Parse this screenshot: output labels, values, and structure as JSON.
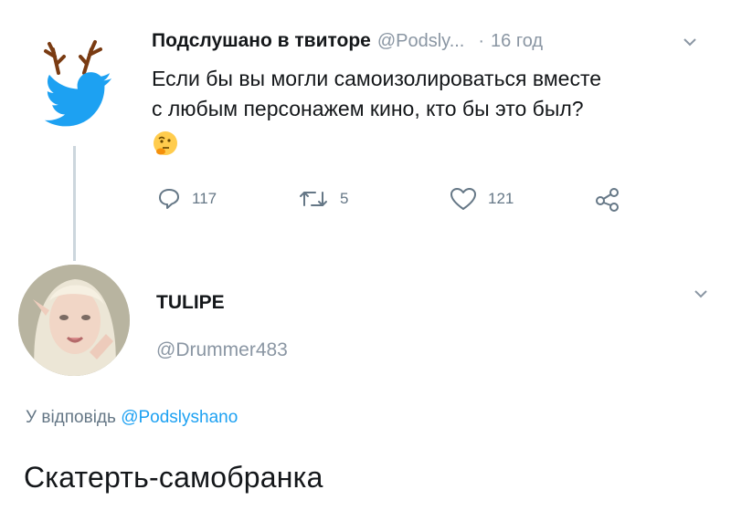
{
  "colors": {
    "accent": "#1da1f2",
    "muted": "#8a96a3",
    "text": "#14171a",
    "antler": "#7a3b12"
  },
  "original_tweet": {
    "avatar_icon": "twitter-bird-with-antlers-icon",
    "author_name": "Подслушано в твиторе",
    "author_handle": "@Podsly...",
    "separator": "·",
    "time": "16 год",
    "text_line1": "Если бы вы могли самоизолироваться вместе",
    "text_line2": "с любым персонажем кино, кто бы это был?",
    "emoji": "thinking-face",
    "actions": {
      "reply_count": "117",
      "retweet_count": "5",
      "like_count": "121"
    }
  },
  "reply_tweet": {
    "avatar_icon": "user-avatar-photo",
    "author_name": "TULIPE",
    "author_handle": "@Drummer483",
    "reply_prefix": "У відповідь",
    "reply_to_handle": "@Podslyshano",
    "text": "Скатерть-самобранка"
  }
}
